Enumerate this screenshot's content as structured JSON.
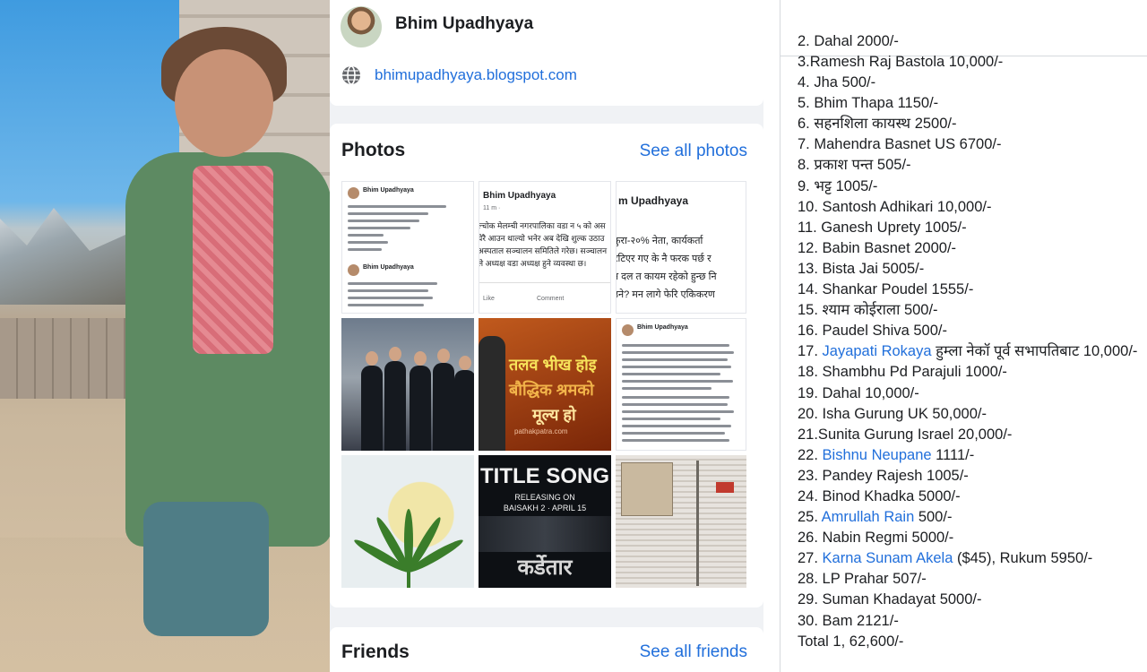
{
  "profile": {
    "name": "Bhim Upadhyaya",
    "website": "bhimupadhyaya.blogspot.com"
  },
  "photos": {
    "title": "Photos",
    "see_all": "See all photos",
    "doc1": {
      "name_a": "Bhim Upadhyaya",
      "name_b": "Bhim Upadhyaya"
    },
    "doc2": {
      "name": "Bhim Upadhyaya",
      "time": "11 m · ",
      "lines": [
        "ल्चोक मेलम्ची नगरपालिका वडा न ५ को अस",
        "घेरै आउन थाल्यो भनेर अब देखि शुल्क उठाउ",
        "अस्पताल सञ्चालन समितिले गरेछ। सञ्चालन",
        "ले अध्यक्ष वडा अध्यक्ष हुने व्यवस्था छ।"
      ],
      "like": "Like",
      "comment": "Comment"
    },
    "doc3": {
      "name": "m Upadhyaya",
      "lines": [
        "कुरा-२०% नेता, कार्यकर्ता ",
        "टेटिएर गए के नै फरक पर्छ र",
        "न दल त कायम रहेको हुन्छ नि",
        "उने? मन लागे फेरि एकिकरण"
      ]
    },
    "quote": {
      "line1": "तलव भीख होइ",
      "line2": "बौद्धिक श्रमको",
      "line3": "मूल्य हो",
      "watermark": "pathakpatra.com"
    },
    "doc4": {
      "name": "Bhim Upadhyaya"
    },
    "film": {
      "title": "TITLE SONG",
      "releasing": "RELEASING ON",
      "date": "BAISAKH 2 · APRIL 15",
      "movie": "कर्डेतार"
    }
  },
  "friends": {
    "title": "Friends",
    "see_all": "See all friends"
  },
  "donors": {
    "clipped_top": "2. Dahal 2000/-",
    "items": [
      [
        "3.Ramesh Raj Bastola 10,000/-"
      ],
      [
        "4. Jha 500/-"
      ],
      [
        "5. Bhim Thapa 1150/-"
      ],
      [
        "6. सहनशिला कायस्थ 2500/-"
      ],
      [
        "7. Mahendra Basnet US 6700/-"
      ],
      [
        "8. प्रकाश पन्त 505/-"
      ],
      [
        "9. भट्ट  1005/-"
      ],
      [
        "10. Santosh Adhikari 10,000/-"
      ],
      [
        "11. Ganesh Uprety 1005/-"
      ],
      [
        "12. Babin Basnet 2000/-"
      ],
      [
        "13. Bista Jai 5005/-"
      ],
      [
        "14. Shankar Poudel 1555/-"
      ],
      [
        "15. श्याम कोईराला 500/-"
      ],
      [
        "16. Paudel Shiva 500/-"
      ]
    ],
    "item17": {
      "num": "17. ",
      "link": "Jayapati Rokaya",
      "rest": " हुम्ला नेकॉ पूर्व सभापतिबाट 10,000/-"
    },
    "items_b": [
      "18. Shambhu Pd Parajuli 1000/-",
      "19. Dahal 10,000/-",
      "20. Isha Gurung UK 50,000/-",
      "21.Sunita Gurung Israel 20,000/-"
    ],
    "item22": {
      "num": "22. ",
      "link": "Bishnu Neupane",
      "rest": " 1111/-"
    },
    "items_c": [
      "23. Pandey Rajesh 1005/-",
      "24. Binod Khadka 5000/-"
    ],
    "item25": {
      "num": "25. ",
      "link": "Amrullah Rain",
      "rest": " 500/-"
    },
    "item26": "26. Nabin Regmi 5000/-",
    "item27": {
      "num": "27. ",
      "link": "Karna Sunam Akela",
      "rest": " ($45), Rukum 5950/-"
    },
    "items_d": [
      "28. LP Prahar 507/-",
      "29. Suman Khadayat 5000/-",
      "30. Bam 2121/-",
      "Total 1, 62,600/-"
    ]
  },
  "colors": {
    "link": "#216fdb",
    "panel_bg": "#f0f2f5"
  }
}
